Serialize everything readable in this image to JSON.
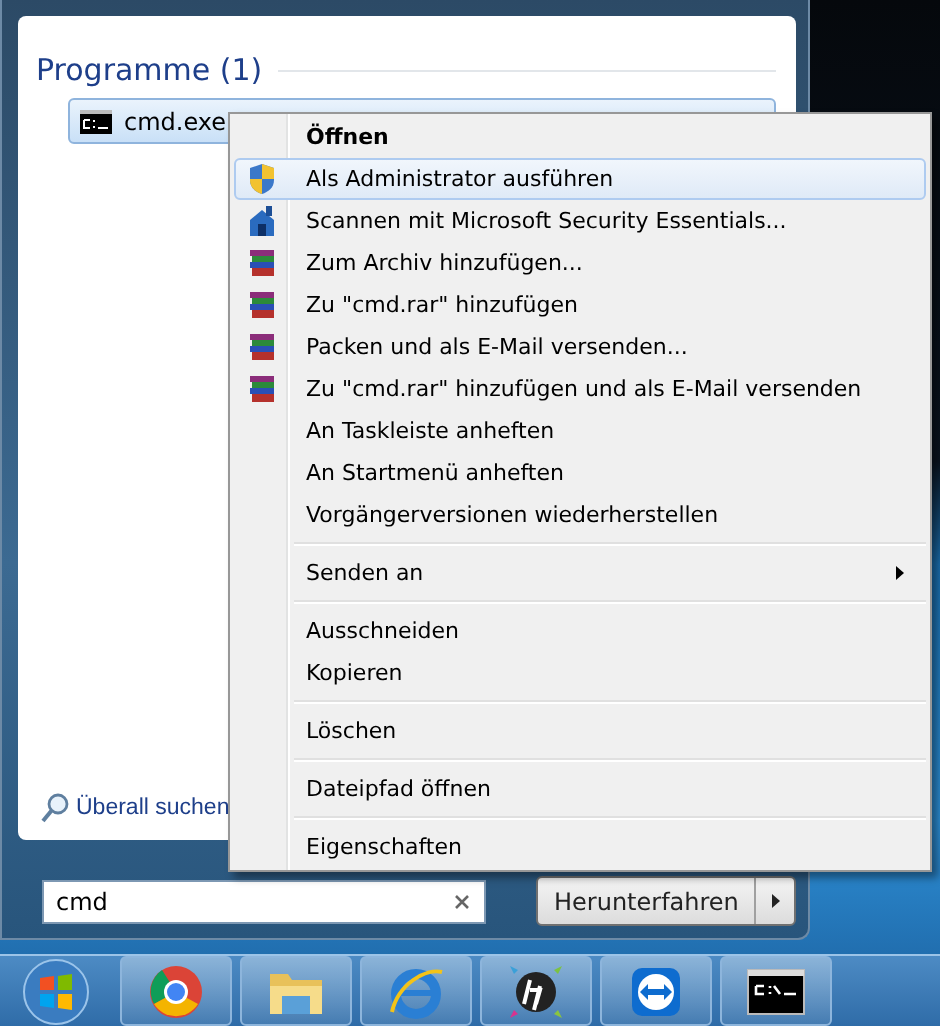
{
  "start_menu": {
    "section_title": "Programme (1)",
    "results": [
      {
        "label": "cmd.exe",
        "selected": true
      }
    ],
    "search_all": "Überall suchen",
    "search": {
      "value": "cmd"
    },
    "shutdown_button": "Herunterfahren"
  },
  "context_menu": {
    "items": [
      {
        "kind": "item",
        "label": "Öffnen",
        "default": true,
        "selected": false
      },
      {
        "kind": "elevated",
        "label": "Als Administrator ausführen",
        "selected": true
      },
      {
        "kind": "scan",
        "label": "Scannen mit Microsoft Security Essentials...",
        "selected": false
      },
      {
        "kind": "archive",
        "label": "Zum Archiv hinzufügen...",
        "selected": false
      },
      {
        "kind": "archive",
        "label": "Zu \"cmd.rar\" hinzufügen",
        "selected": false
      },
      {
        "kind": "archive",
        "label": "Packen und als E-Mail versenden...",
        "selected": false
      },
      {
        "kind": "archive",
        "label": "Zu \"cmd.rar\" hinzufügen und als E-Mail versenden",
        "selected": false
      },
      {
        "kind": "item",
        "label": "An Taskleiste anheften",
        "selected": false
      },
      {
        "kind": "item",
        "label": "An Startmenü anheften",
        "selected": false
      },
      {
        "kind": "item",
        "label": "Vorgängerversionen wiederherstellen",
        "selected": false
      },
      {
        "kind": "separator"
      },
      {
        "kind": "item",
        "label": "Senden an",
        "submenu": true,
        "selected": false
      },
      {
        "kind": "separator"
      },
      {
        "kind": "item",
        "label": "Ausschneiden",
        "selected": false
      },
      {
        "kind": "item",
        "label": "Kopieren",
        "selected": false
      },
      {
        "kind": "separator"
      },
      {
        "kind": "item",
        "label": "Löschen",
        "selected": false
      },
      {
        "kind": "separator"
      },
      {
        "kind": "item",
        "label": "Dateipfad öffnen",
        "selected": false
      },
      {
        "kind": "separator"
      },
      {
        "kind": "item",
        "label": "Eigenschaften",
        "selected": false
      }
    ]
  },
  "taskbar": {
    "items": [
      {
        "kind": "start"
      },
      {
        "kind": "browser"
      },
      {
        "kind": "folder"
      },
      {
        "kind": "ie"
      },
      {
        "kind": "hp"
      },
      {
        "kind": "remote"
      },
      {
        "kind": "console"
      }
    ]
  }
}
